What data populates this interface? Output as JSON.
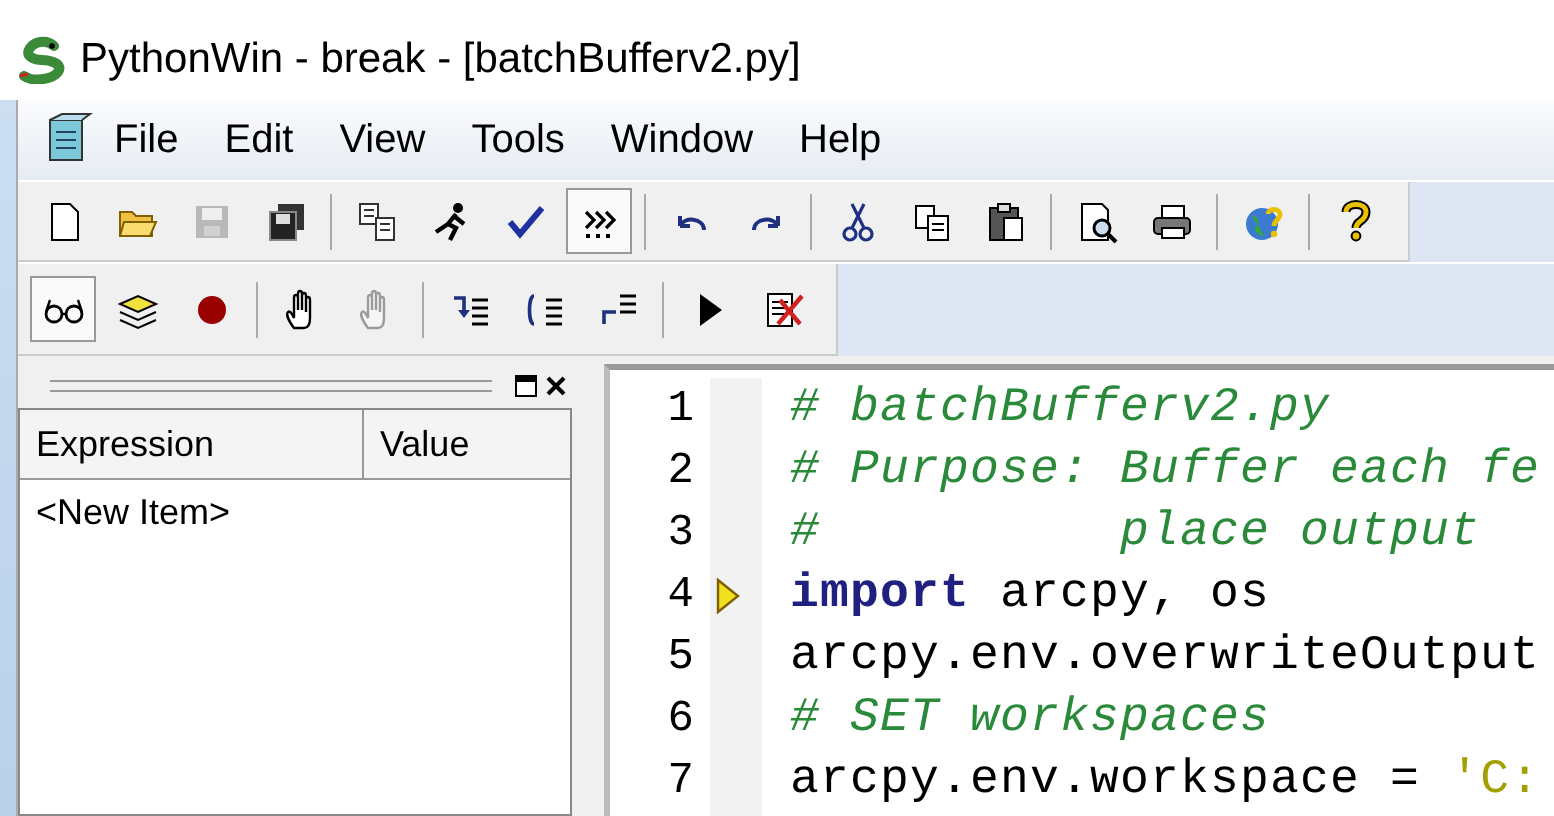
{
  "window": {
    "title": "PythonWin - break - [batchBufferv2.py]"
  },
  "menu": [
    {
      "label": "File"
    },
    {
      "label": "Edit"
    },
    {
      "label": "View"
    },
    {
      "label": "Tools"
    },
    {
      "label": "Window"
    },
    {
      "label": "Help"
    }
  ],
  "toolbars": [
    [
      [
        {
          "kind": "new",
          "pressed": false,
          "disabled": false
        },
        {
          "kind": "open",
          "pressed": false,
          "disabled": false
        },
        {
          "kind": "save",
          "pressed": false,
          "disabled": true
        },
        {
          "kind": "saveall",
          "pressed": false,
          "disabled": false
        }
      ],
      [
        {
          "kind": "copyto",
          "pressed": false,
          "disabled": false
        },
        {
          "kind": "run",
          "pressed": false,
          "disabled": false
        },
        {
          "kind": "check",
          "pressed": false,
          "disabled": false
        },
        {
          "kind": "step",
          "pressed": true,
          "disabled": false
        }
      ],
      [
        {
          "kind": "undo",
          "pressed": false,
          "disabled": false
        },
        {
          "kind": "redo",
          "pressed": false,
          "disabled": false
        }
      ],
      [
        {
          "kind": "cut",
          "pressed": false,
          "disabled": false
        },
        {
          "kind": "copy",
          "pressed": false,
          "disabled": false
        },
        {
          "kind": "paste",
          "pressed": false,
          "disabled": false
        }
      ],
      [
        {
          "kind": "preview",
          "pressed": false,
          "disabled": false
        },
        {
          "kind": "print",
          "pressed": false,
          "disabled": false
        }
      ],
      [
        {
          "kind": "globe",
          "pressed": false,
          "disabled": false
        }
      ],
      [
        {
          "kind": "question",
          "pressed": false,
          "disabled": false
        }
      ]
    ],
    [
      [
        {
          "kind": "glasses",
          "pressed": true,
          "disabled": false
        },
        {
          "kind": "stack",
          "pressed": false,
          "disabled": false
        },
        {
          "kind": "breakpoint",
          "pressed": false,
          "disabled": false
        }
      ],
      [
        {
          "kind": "hand",
          "pressed": false,
          "disabled": false
        },
        {
          "kind": "hand",
          "pressed": false,
          "disabled": true
        }
      ],
      [
        {
          "kind": "stepin",
          "pressed": false,
          "disabled": false
        },
        {
          "kind": "stepover",
          "pressed": false,
          "disabled": false
        },
        {
          "kind": "stepout",
          "pressed": false,
          "disabled": false
        }
      ],
      [
        {
          "kind": "go",
          "pressed": false,
          "disabled": false
        },
        {
          "kind": "closedebug",
          "pressed": false,
          "disabled": false
        }
      ]
    ]
  ],
  "watch": {
    "columns": [
      "Expression",
      "Value"
    ],
    "rows": [
      "<New Item>"
    ]
  },
  "editor": {
    "lines": [
      {
        "number": "1",
        "current": false,
        "segments": [
          {
            "kind": "comment",
            "text": "# batchBufferv2.py"
          }
        ]
      },
      {
        "number": "2",
        "current": false,
        "segments": [
          {
            "kind": "comment",
            "text": "# Purpose: Buffer each fe"
          }
        ]
      },
      {
        "number": "3",
        "current": false,
        "segments": [
          {
            "kind": "comment",
            "text": "#          place output"
          }
        ]
      },
      {
        "number": "4",
        "current": true,
        "segments": [
          {
            "kind": "keyword",
            "text": "import"
          },
          {
            "kind": "plain",
            "text": " arcpy, os"
          }
        ]
      },
      {
        "number": "5",
        "current": false,
        "segments": [
          {
            "kind": "plain",
            "text": "arcpy.env.overwriteOutput"
          }
        ]
      },
      {
        "number": "6",
        "current": false,
        "segments": [
          {
            "kind": "comment",
            "text": "# SET workspaces"
          }
        ]
      },
      {
        "number": "7",
        "current": false,
        "segments": [
          {
            "kind": "plain",
            "text": "arcpy.env.workspace = "
          },
          {
            "kind": "string",
            "text": "'C:"
          }
        ]
      }
    ]
  }
}
